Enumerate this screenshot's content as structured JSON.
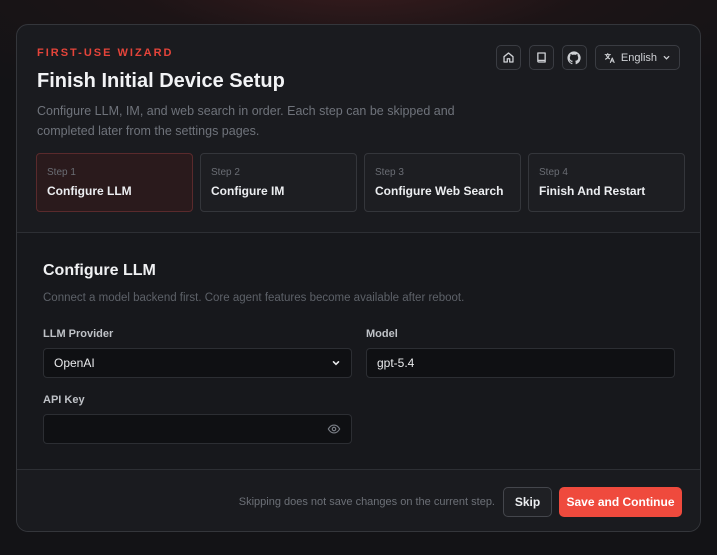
{
  "header": {
    "eyebrow": "FIRST-USE WIZARD",
    "title": "Finish Initial Device Setup",
    "subtitle": "Configure LLM, IM, and web search in order. Each step can be skipped and completed later from the settings pages.",
    "language_label": "English"
  },
  "toolbar": {
    "icons": [
      "home-icon",
      "book-icon",
      "github-icon",
      "translate-icon",
      "chevron-down-icon"
    ]
  },
  "steps": [
    {
      "number": "Step 1",
      "name": "Configure LLM",
      "active": true
    },
    {
      "number": "Step 2",
      "name": "Configure IM",
      "active": false
    },
    {
      "number": "Step 3",
      "name": "Configure Web Search",
      "active": false
    },
    {
      "number": "Step 4",
      "name": "Finish And Restart",
      "active": false
    }
  ],
  "section": {
    "title": "Configure LLM",
    "description": "Connect a model backend first. Core agent features become available after reboot."
  },
  "form": {
    "provider_label": "LLM Provider",
    "provider_value": "OpenAI",
    "model_label": "Model",
    "model_value": "gpt-5.4",
    "api_key_label": "API Key",
    "api_key_value": ""
  },
  "footer": {
    "note": "Skipping does not save changes on the current step.",
    "skip_label": "Skip",
    "primary_label": "Save and Continue"
  },
  "colors": {
    "accent": "#ef4a3d",
    "eyebrow": "#e5443a",
    "background": "#141417",
    "card": "#1a1b1f"
  }
}
